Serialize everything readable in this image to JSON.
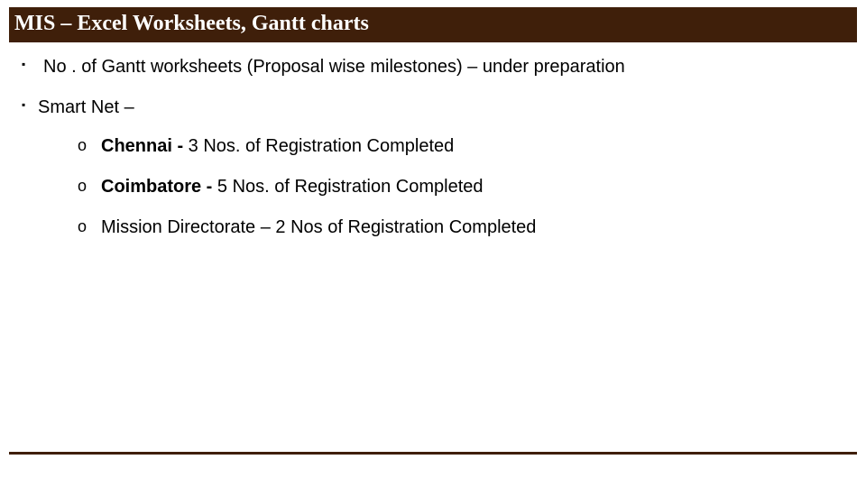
{
  "title": "MIS – Excel Worksheets,  Gantt charts",
  "bullets": [
    {
      "text": "No . of Gantt worksheets (Proposal wise milestones) – under preparation"
    },
    {
      "text": "Smart Net –",
      "sub": [
        {
          "bold": "Chennai -",
          "rest": "  3 Nos. of Registration Completed"
        },
        {
          "bold": "Coimbatore -",
          "rest": "  5 Nos. of Registration Completed"
        },
        {
          "bold": "",
          "rest": "Mission Directorate – 2 Nos of Registration Completed"
        }
      ]
    }
  ],
  "colors": {
    "bar": "#3f1f0a"
  }
}
